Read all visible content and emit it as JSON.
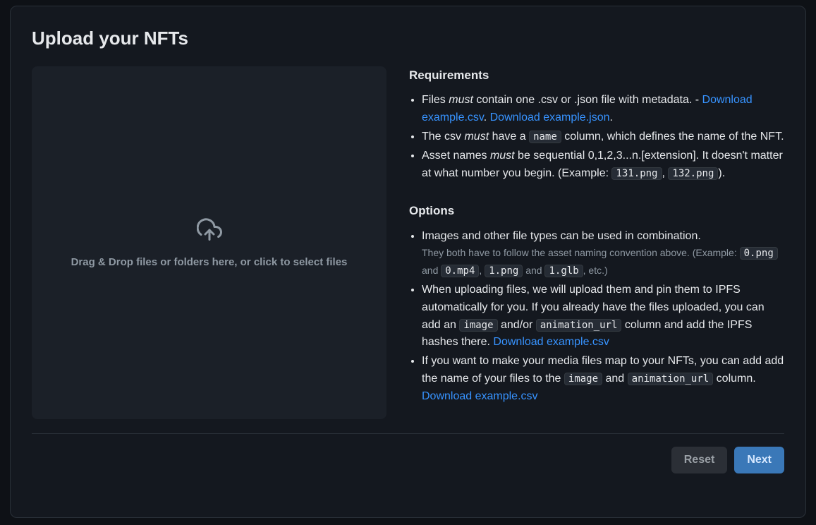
{
  "title": "Upload your NFTs",
  "dropzone": {
    "text": "Drag & Drop files or folders here, or click to select files"
  },
  "requirements": {
    "heading": "Requirements",
    "item1": {
      "prefix": "Files ",
      "emph": "must",
      "rest": " contain one .csv or .json file with metadata. - ",
      "link1": "Download example.csv",
      "sep": ". ",
      "link2": "Download example.json",
      "end": "."
    },
    "item2": {
      "prefix": "The csv ",
      "emph": "must",
      "mid": " have a ",
      "code": "name",
      "rest": " column, which defines the name of the NFT."
    },
    "item3": {
      "prefix": "Asset names ",
      "emph": "must",
      "mid": " be sequential 0,1,2,3...n.[extension]. It doesn't matter at what number you begin. (Example: ",
      "code1": "131.png",
      "sep": ", ",
      "code2": "132.png",
      "end": ")."
    }
  },
  "options": {
    "heading": "Options",
    "item1": {
      "main": "Images and other file types can be used in combination.",
      "sub_prefix": "They both have to follow the asset naming convention above. (Example: ",
      "c1": "0.png",
      "s1": " and ",
      "c2": "0.mp4",
      "s2": ", ",
      "c3": "1.png",
      "s3": " and ",
      "c4": "1.glb",
      "s4": ", etc.)"
    },
    "item2": {
      "prefix": "When uploading files, we will upload them and pin them to IPFS automatically for you. If you already have the files uploaded, you can add an ",
      "code1": "image",
      "mid": " and/or ",
      "code2": "animation_url",
      "rest": " column and add the IPFS hashes there. ",
      "link": "Download example.csv"
    },
    "item3": {
      "prefix": "If you want to make your media files map to your NFTs, you can add add the name of your files to the ",
      "code1": "image",
      "mid": " and ",
      "code2": "animation_url",
      "rest": " column. ",
      "link": "Download example.csv"
    }
  },
  "footer": {
    "reset": "Reset",
    "next": "Next"
  }
}
